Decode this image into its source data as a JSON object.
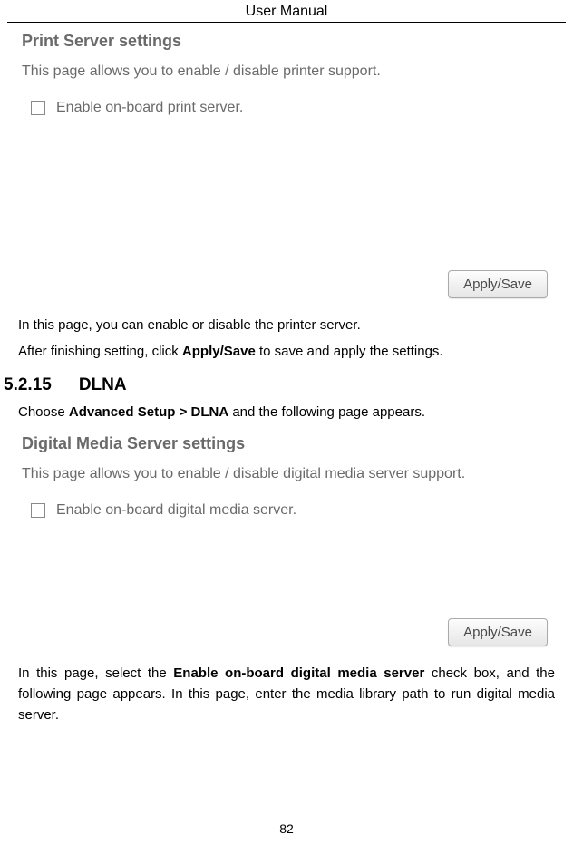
{
  "header": {
    "title": "User Manual"
  },
  "screenshot1": {
    "title": "Print Server settings",
    "description": "This page allows you to enable / disable printer support.",
    "checkbox_label": "Enable on-board print server.",
    "button_label": "Apply/Save"
  },
  "para1": {
    "line1": "In this page, you can enable or disable the printer server.",
    "line2_prefix": "After finishing setting, click ",
    "line2_bold": "Apply/Save",
    "line2_suffix": " to save and apply the settings."
  },
  "section": {
    "number": "5.2.15",
    "title": "DLNA"
  },
  "choose": {
    "prefix": "Choose ",
    "bold": "Advanced Setup > DLNA",
    "suffix": " and the following page appears."
  },
  "screenshot2": {
    "title": "Digital Media Server settings",
    "description": "This page allows you to enable / disable digital media server support.",
    "checkbox_label": "Enable on-board digital media server.",
    "button_label": "Apply/Save"
  },
  "para2": {
    "prefix": "In this page, select the ",
    "bold": "Enable on-board digital media server",
    "suffix": " check box, and the following page appears. In this page, enter the media library path to run digital media server."
  },
  "page_number": "82"
}
